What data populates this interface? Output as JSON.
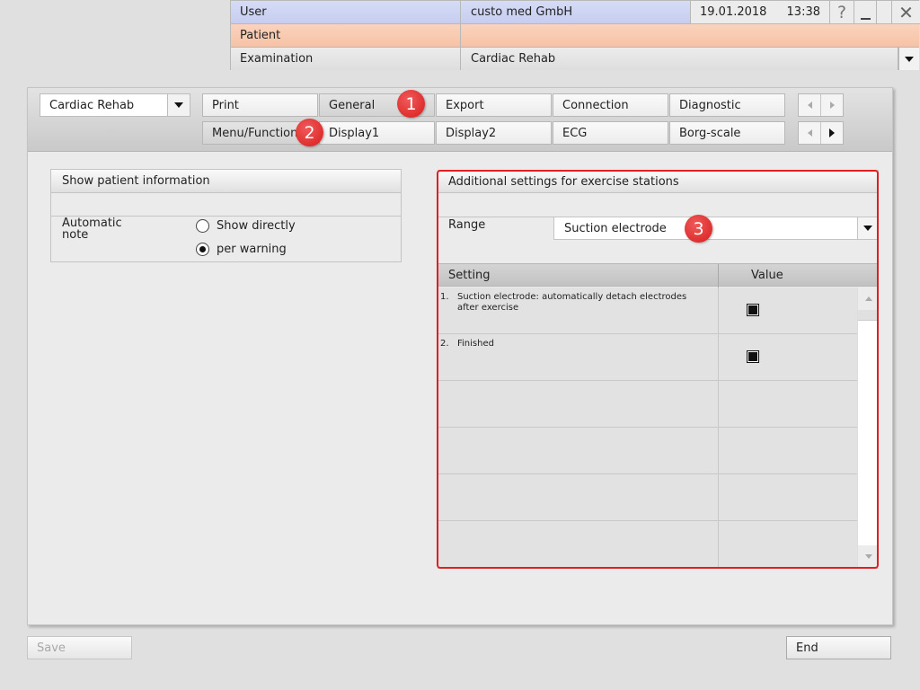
{
  "header": {
    "user_label": "User",
    "user_value": "custo med GmbH",
    "date": "19.01.2018",
    "time": "13:38",
    "help_glyph": "?",
    "close_glyph": "✕",
    "patient_label": "Patient",
    "patient_value": "",
    "examination_label": "Examination",
    "examination_value": "Cardiac Rehab",
    "colors": {
      "user_row": "#c6cdef",
      "patient_row": "#f6c2a5"
    }
  },
  "toolbar": {
    "combo_value": "Cardiac Rehab",
    "tabs_row1": [
      "Print",
      "General",
      "Export",
      "Connection",
      "Diagnostic"
    ],
    "tabs_row2": [
      "Menu/Functions",
      "Display1",
      "Display2",
      "ECG",
      "Borg-scale"
    ],
    "active_tab": "General"
  },
  "left_panel": {
    "title": "Show patient information",
    "auto_note_label": "Automatic\nnote",
    "radio_options": [
      {
        "label": "Show directly",
        "selected": false
      },
      {
        "label": "per warning",
        "selected": true
      }
    ]
  },
  "right_panel": {
    "title": "Additional settings for exercise stations",
    "range_label": "Range",
    "range_value": "Suction electrode",
    "table": {
      "col_setting": "Setting",
      "col_value": "Value",
      "rows": [
        {
          "num": "1.",
          "text": "Suction electrode:  automatically detach electrodes after exercise",
          "checked": true
        },
        {
          "num": "2.",
          "text": "Finished",
          "checked": true
        }
      ]
    }
  },
  "annotations": {
    "badge1": "1",
    "badge2": "2",
    "badge3": "3",
    "color": "#e02020"
  },
  "footer": {
    "save_label": "Save",
    "end_label": "End"
  }
}
